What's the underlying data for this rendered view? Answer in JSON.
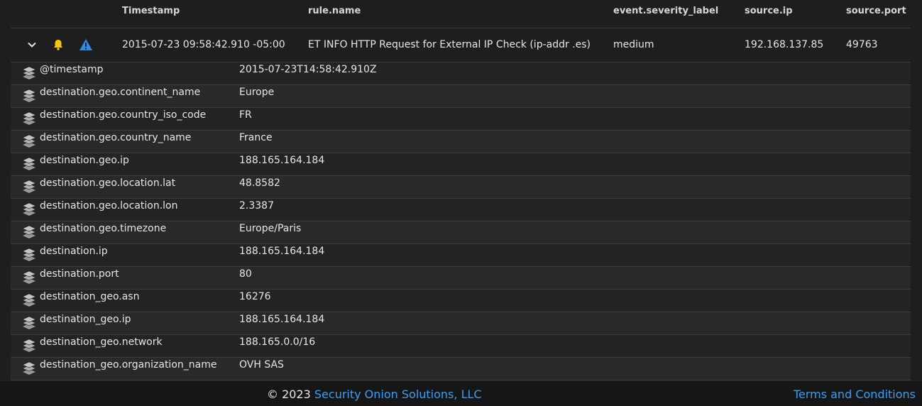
{
  "table": {
    "headers": [
      "Timestamp",
      "rule.name",
      "event.severity_label",
      "source.ip",
      "source.port"
    ]
  },
  "event": {
    "timestamp": "2015-07-23 09:58:42.910 -05:00",
    "rule_name": "ET INFO HTTP Request for External IP Check (ip-addr .es)",
    "severity": "medium",
    "source_ip": "192.168.137.85",
    "source_port": "49763"
  },
  "icons": {
    "expand": "chevron-down-icon",
    "ack": "bell-icon",
    "escalate": "warning-triangle-icon",
    "field_action": "layers-icon"
  },
  "colors": {
    "bell": "#f5c518",
    "warning": "#2e8de0",
    "link": "#3d9df3"
  },
  "fields": [
    {
      "name": "@timestamp",
      "value": "2015-07-23T14:58:42.910Z"
    },
    {
      "name": "destination.geo.continent_name",
      "value": "Europe"
    },
    {
      "name": "destination.geo.country_iso_code",
      "value": "FR"
    },
    {
      "name": "destination.geo.country_name",
      "value": "France"
    },
    {
      "name": "destination.geo.ip",
      "value": "188.165.164.184"
    },
    {
      "name": "destination.geo.location.lat",
      "value": "48.8582"
    },
    {
      "name": "destination.geo.location.lon",
      "value": "2.3387"
    },
    {
      "name": "destination.geo.timezone",
      "value": "Europe/Paris"
    },
    {
      "name": "destination.ip",
      "value": "188.165.164.184"
    },
    {
      "name": "destination.port",
      "value": "80"
    },
    {
      "name": "destination_geo.asn",
      "value": "16276"
    },
    {
      "name": "destination_geo.ip",
      "value": "188.165.164.184"
    },
    {
      "name": "destination_geo.network",
      "value": "188.165.0.0/16"
    },
    {
      "name": "destination_geo.organization_name",
      "value": "OVH SAS"
    }
  ],
  "footer": {
    "copyright_prefix": "© 2023 ",
    "company": "Security Onion Solutions, LLC",
    "terms": "Terms and Conditions"
  }
}
